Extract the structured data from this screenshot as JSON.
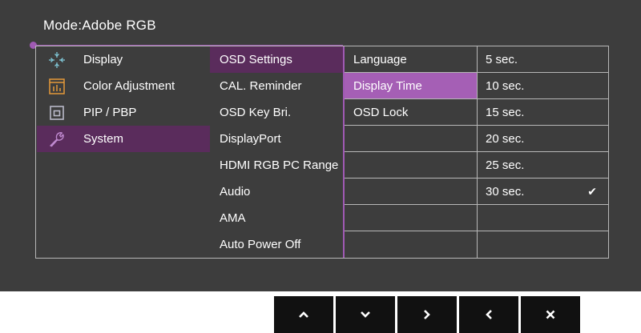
{
  "header": {
    "mode_text": "Mode:Adobe RGB"
  },
  "menu": [
    {
      "label": "Display",
      "icon": "display-icon"
    },
    {
      "label": "Color Adjustment",
      "icon": "color-adjustment-icon"
    },
    {
      "label": "PIP / PBP",
      "icon": "pip-pbp-icon"
    },
    {
      "label": "System",
      "icon": "wrench-icon",
      "selected": true
    }
  ],
  "system_items": [
    {
      "label": "OSD Settings",
      "selected": true
    },
    {
      "label": "CAL. Reminder"
    },
    {
      "label": "OSD Key Bri."
    },
    {
      "label": "DisplayPort"
    },
    {
      "label": "HDMI RGB PC Range"
    },
    {
      "label": "Audio"
    },
    {
      "label": "AMA"
    },
    {
      "label": "Auto Power Off"
    }
  ],
  "osd_settings_items": [
    {
      "label": "Language"
    },
    {
      "label": "Display Time",
      "selected": true
    },
    {
      "label": "OSD Lock"
    },
    {
      "label": ""
    },
    {
      "label": ""
    },
    {
      "label": ""
    },
    {
      "label": ""
    },
    {
      "label": ""
    }
  ],
  "display_time_options": [
    {
      "label": "5 sec."
    },
    {
      "label": "10 sec."
    },
    {
      "label": "15 sec."
    },
    {
      "label": "20 sec."
    },
    {
      "label": "25 sec."
    },
    {
      "label": "30 sec.",
      "checked": true,
      "check_mark": "✔"
    },
    {
      "label": ""
    },
    {
      "label": ""
    }
  ],
  "control_buttons": [
    {
      "name": "up-button",
      "icon": "chevron-up-icon"
    },
    {
      "name": "down-button",
      "icon": "chevron-down-icon"
    },
    {
      "name": "right-button",
      "icon": "chevron-right-icon"
    },
    {
      "name": "left-button",
      "icon": "chevron-left-icon"
    },
    {
      "name": "close-button",
      "icon": "close-icon"
    }
  ],
  "colors": {
    "accent": "#a05ab4",
    "selected_dark": "#5a2c5c",
    "selected_light": "#a55fb5",
    "background": "#3d3d3d"
  }
}
